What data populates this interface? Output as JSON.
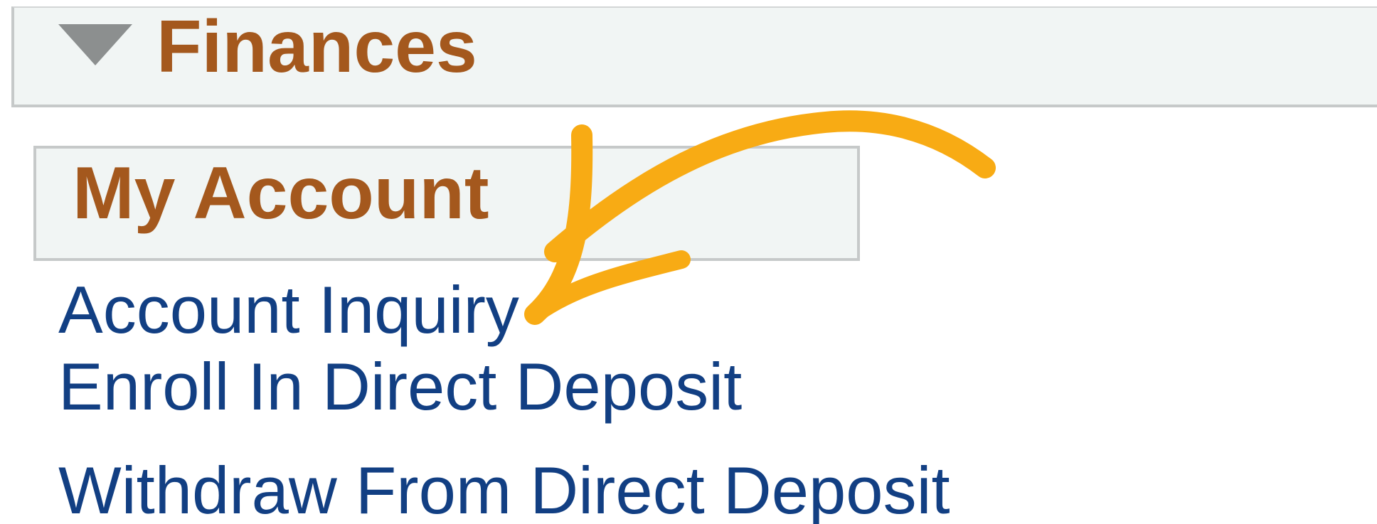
{
  "section": {
    "title": "Finances",
    "toggle_icon": "triangle-down-icon"
  },
  "subsection": {
    "title": "My Account"
  },
  "menu": {
    "items": [
      {
        "label": "Account Inquiry"
      },
      {
        "label": "Enroll In Direct Deposit"
      },
      {
        "label": "Withdraw From Direct Deposit"
      }
    ]
  },
  "colors": {
    "heading": "#a4581d",
    "link": "#123f83",
    "panel_bg": "#f1f5f4",
    "panel_border": "#c6c9c9",
    "arrow": "#f8ab14"
  },
  "annotation": {
    "icon": "curved-arrow-icon"
  }
}
